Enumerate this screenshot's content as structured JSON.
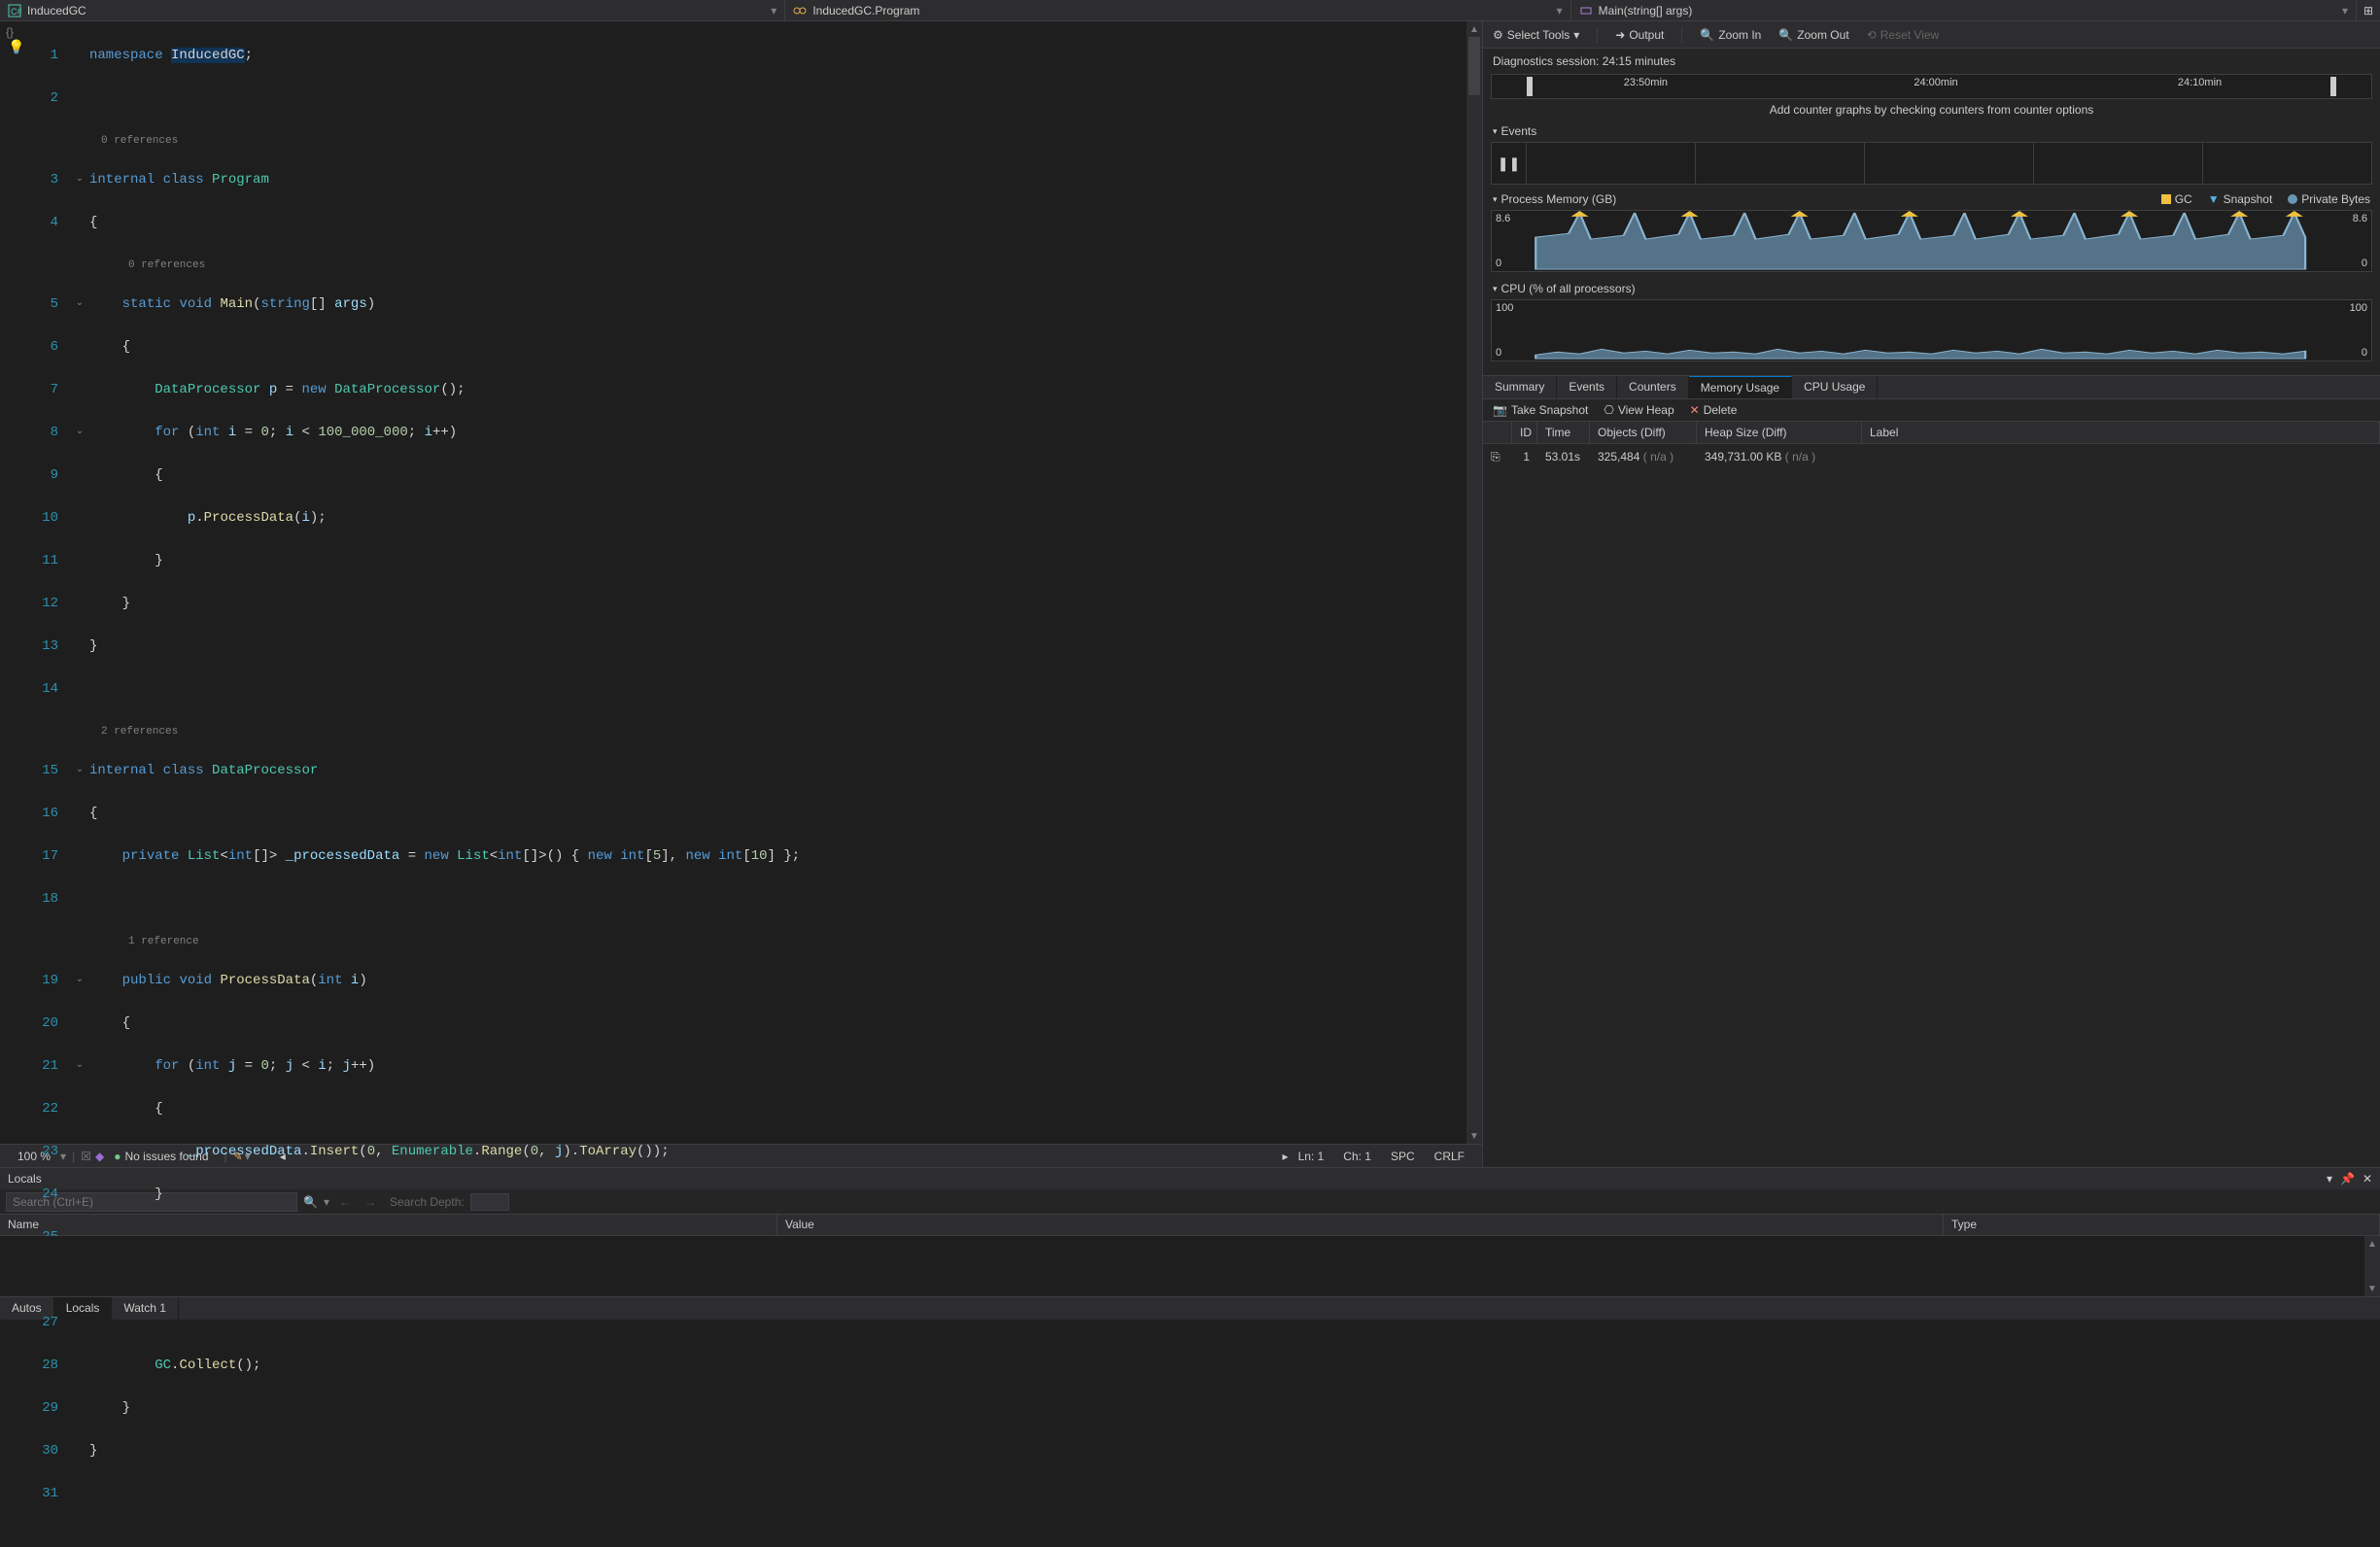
{
  "nav": {
    "crumb1": "InducedGC",
    "crumb2": "InducedGC.Program",
    "crumb3": "Main(string[] args)"
  },
  "code": {
    "codelens0": "0 references",
    "codelens1": "0 references",
    "codelens2": "2 references",
    "codelens3": "1 reference"
  },
  "status": {
    "zoom": "100 %",
    "issues": "No issues found",
    "ln": "Ln: 1",
    "ch": "Ch: 1",
    "spc": "SPC",
    "eol": "CRLF"
  },
  "diag": {
    "toolbar": {
      "select_tools": "Select Tools",
      "output": "Output",
      "zoom_in": "Zoom In",
      "zoom_out": "Zoom Out",
      "reset_view": "Reset View"
    },
    "session": "Diagnostics session: 24:15 minutes",
    "timeline": {
      "t1": "23:50min",
      "t2": "24:00min",
      "t3": "24:10min"
    },
    "hint": "Add counter graphs by checking counters from counter options",
    "events_hdr": "Events",
    "pm_hdr": "Process Memory (GB)",
    "pm_legend": {
      "gc": "GC",
      "snap": "Snapshot",
      "priv": "Private Bytes"
    },
    "pm_y_top": "8.6",
    "pm_y_bot": "0",
    "cpu_hdr": "CPU (% of all processors)",
    "cpu_y_top": "100",
    "cpu_y_bot": "0",
    "tabs": {
      "summary": "Summary",
      "events": "Events",
      "counters": "Counters",
      "memory": "Memory Usage",
      "cpu": "CPU Usage"
    },
    "snapbar": {
      "take": "Take Snapshot",
      "view": "View Heap",
      "delete": "Delete"
    },
    "cols": {
      "id": "ID",
      "time": "Time",
      "objects": "Objects (Diff)",
      "heap": "Heap Size (Diff)",
      "label": "Label"
    },
    "row": {
      "id": "1",
      "time": "53.01s",
      "objects": "325,484",
      "objects_diff": "( n/a )",
      "heap": "349,731.00 KB",
      "heap_diff": "( n/a )"
    }
  },
  "locals": {
    "title": "Locals",
    "search_ph": "Search (Ctrl+E)",
    "depth_label": "Search Depth:",
    "col_name": "Name",
    "col_value": "Value",
    "col_type": "Type"
  },
  "btabs": {
    "autos": "Autos",
    "locals": "Locals",
    "watch1": "Watch 1"
  },
  "chart_data": [
    {
      "type": "area",
      "title": "Process Memory (GB)",
      "ylabel": "GB",
      "ylim": [
        0,
        8.6
      ],
      "x_range_minutes": [
        23.75,
        24.25
      ],
      "series": [
        {
          "name": "Private Bytes",
          "values": [
            5.0,
            5.5,
            8.6,
            4.8,
            5.3,
            8.6,
            4.9,
            5.4,
            8.6,
            4.8,
            5.2,
            8.6,
            4.9,
            5.4,
            8.6,
            4.8,
            5.3,
            8.6,
            4.9,
            5.3,
            8.6,
            4.8,
            5.2,
            8.6,
            5.0
          ]
        }
      ],
      "markers": {
        "GC": 8,
        "Snapshot": 1
      }
    },
    {
      "type": "area",
      "title": "CPU (% of all processors)",
      "ylabel": "%",
      "ylim": [
        0,
        100
      ],
      "x_range_minutes": [
        23.75,
        24.25
      ],
      "series": [
        {
          "name": "CPU",
          "values": [
            8,
            12,
            10,
            9,
            14,
            8,
            11,
            9,
            13,
            8,
            12,
            10,
            9,
            14,
            8,
            11,
            9,
            12,
            10,
            9,
            13,
            8,
            11,
            10,
            9
          ]
        }
      ]
    }
  ]
}
